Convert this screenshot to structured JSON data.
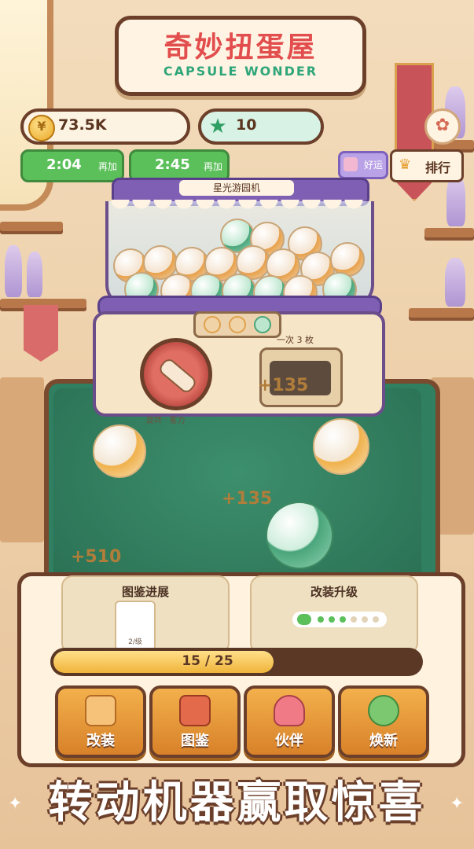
{
  "title": {
    "cn": "奇妙扭蛋屋",
    "en": "CAPSULE WONDER"
  },
  "resources": {
    "coins": "73.5K",
    "gems": "10",
    "coin_icon": "coin-icon",
    "gem_icon": "star-gem-icon"
  },
  "timers": [
    {
      "time": "2:04",
      "label": "再加"
    },
    {
      "time": "2:45",
      "label": "再加"
    }
  ],
  "luck_label": "好运",
  "rank_label": "排行",
  "machine": {
    "name": "星光游园机",
    "per_draw": "一次 3 枚",
    "tip": "旋转 · 蓄力",
    "floating_scores": [
      "+135",
      "+135",
      "+510"
    ]
  },
  "collection": {
    "title": "图鉴进展",
    "card_level": "2/级"
  },
  "upgrade": {
    "title": "改装升级"
  },
  "progress": {
    "text": "15 / 25",
    "current": 15,
    "total": 25
  },
  "buttons": [
    {
      "label": "改装",
      "icon": "hammer-icon"
    },
    {
      "label": "图鉴",
      "icon": "book-icon"
    },
    {
      "label": "伙伴",
      "icon": "bag-icon"
    },
    {
      "label": "焕新",
      "icon": "refresh-icon"
    }
  ],
  "slogan": "转动机器赢取惊喜",
  "colors": {
    "accent_red": "#e24d4d",
    "accent_green": "#2fa67a",
    "brown": "#6b3f2a",
    "purple": "#7e5fb3"
  }
}
